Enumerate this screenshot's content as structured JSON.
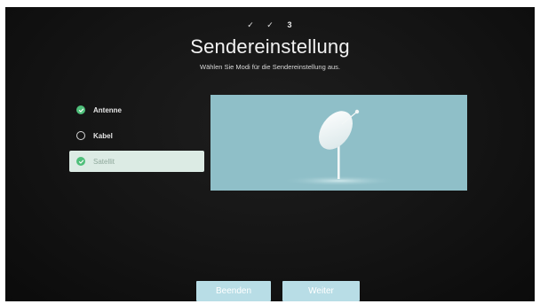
{
  "header": {
    "steps": [
      "✓",
      "✓",
      "3"
    ],
    "title": "Sendereinstellung",
    "subtitle": "Wählen Sie Modi für die Sendereinstellung aus."
  },
  "options": [
    {
      "label": "Antenne",
      "state": "checked"
    },
    {
      "label": "Kabel",
      "state": "unchecked"
    },
    {
      "label": "Satellit",
      "state": "checked",
      "selected": true
    }
  ],
  "preview": {
    "icon": "satellite-dish-icon"
  },
  "buttons": {
    "beenden": "Beenden",
    "weiter": "Weiter"
  },
  "colors": {
    "accent_green": "#4fbf7a",
    "button_bg": "#b8dde6",
    "preview_bg": "#8fbfc8",
    "selected_bg": "#dcebe4"
  }
}
